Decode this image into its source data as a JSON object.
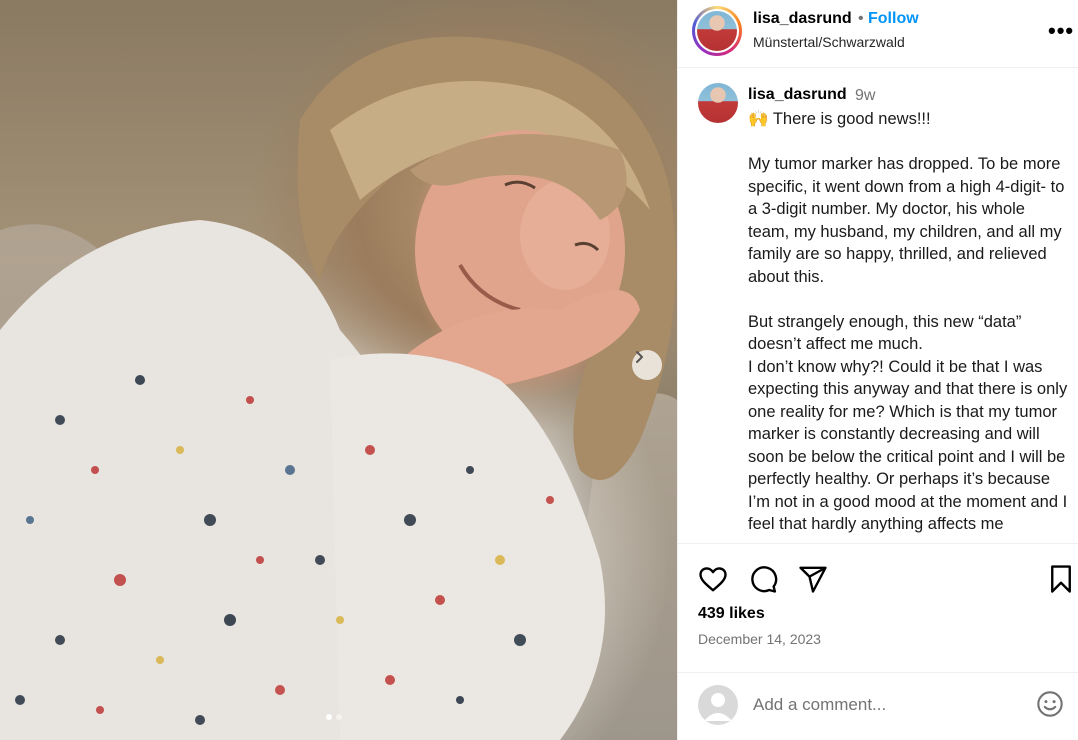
{
  "post": {
    "username": "lisa_dasrund",
    "separator": "•",
    "follow_label": "Follow",
    "location": "Münstertal/Schwarzwald",
    "more_icon": "more-options-icon",
    "more_label": "•••"
  },
  "caption": {
    "username": "lisa_dasrund",
    "time": "9w",
    "text": "🙌 There is good news!!!\n\nMy tumor marker has dropped. To be more specific, it went down from a high 4-digit- to a 3-digit number. My doctor, his whole team, my husband, my children, and all my family are so happy, thrilled, and relieved about this.\n\nBut strangely enough, this new “data” doesn’t affect me much.\nI don’t know why?! Could it be that I was expecting this anyway and that there is only one reality for me? Which is that my tumor marker is constantly decreasing and will soon be below the critical point and I will be perfectly healthy. Or perhaps it’s because I’m not in a good mood at the moment and I feel that hardly anything affects me"
  },
  "carousel": {
    "total": 2,
    "active_index": 0,
    "next_icon": "chevron-right-icon"
  },
  "actions": {
    "icons": [
      "heart-icon",
      "comment-icon",
      "share-icon",
      "bookmark-icon"
    ]
  },
  "stats": {
    "likes": "439 likes",
    "date": "December 14, 2023"
  },
  "comment": {
    "placeholder": "Add a comment...",
    "emoji_icon": "emoji-icon"
  },
  "colors": {
    "accent": "#0095f6",
    "muted_text": "#737373",
    "divider": "#efefef"
  }
}
